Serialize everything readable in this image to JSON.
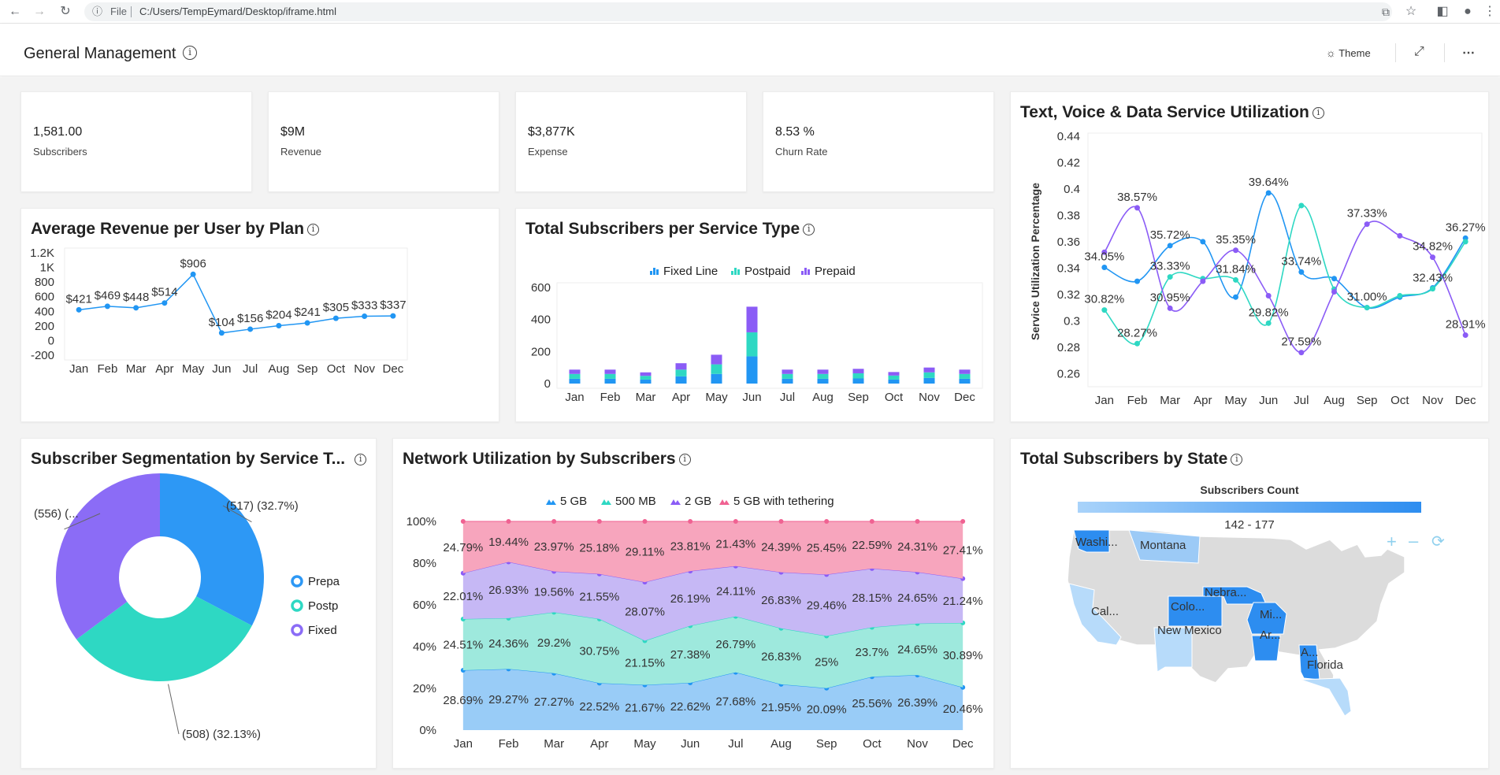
{
  "browser": {
    "file_label": "File",
    "url": "C:/Users/TempEymard/Desktop/iframe.html"
  },
  "header": {
    "title": "General Management",
    "theme_label": "Theme"
  },
  "kpis": [
    {
      "value": "1,581.00",
      "label": "Subscribers"
    },
    {
      "value": "$9M",
      "label": "Revenue"
    },
    {
      "value": "$3,877K",
      "label": "Expense"
    },
    {
      "value": "8.53 %",
      "label": "Churn Rate"
    }
  ],
  "arpu": {
    "title": "Average Revenue per User by Plan",
    "chart_data": {
      "type": "line",
      "categories": [
        "Jan",
        "Feb",
        "Mar",
        "Apr",
        "May",
        "Jun",
        "Jul",
        "Aug",
        "Sep",
        "Oct",
        "Nov",
        "Dec"
      ],
      "values": [
        421,
        469,
        448,
        514,
        906,
        104,
        156,
        204,
        241,
        305,
        333,
        337
      ],
      "labels": [
        "$421",
        "$469",
        "$448",
        "$514",
        "$906",
        "$104",
        "$156",
        "$204",
        "$241",
        "$305",
        "$333",
        "$337"
      ],
      "yticks": [
        "1.2K",
        "1K",
        "800",
        "600",
        "400",
        "200",
        "0",
        "-200"
      ],
      "ylim": [
        -200,
        1200
      ],
      "color": "#2196f3"
    }
  },
  "service_type": {
    "title": "Total Subscribers per Service Type",
    "chart_data": {
      "type": "bar",
      "stacked": true,
      "categories": [
        "Jan",
        "Feb",
        "Mar",
        "Apr",
        "May",
        "Jun",
        "Jul",
        "Aug",
        "Sep",
        "Oct",
        "Nov",
        "Dec"
      ],
      "series": [
        {
          "name": "Fixed Line",
          "color": "#2196f3",
          "values": [
            30,
            30,
            25,
            45,
            60,
            170,
            30,
            30,
            32,
            25,
            35,
            30
          ]
        },
        {
          "name": "Postpaid",
          "color": "#2ed8c3",
          "values": [
            30,
            30,
            23,
            42,
            60,
            150,
            30,
            30,
            32,
            25,
            35,
            30
          ]
        },
        {
          "name": "Prepaid",
          "color": "#8b5cf6",
          "values": [
            27,
            27,
            22,
            40,
            60,
            160,
            27,
            27,
            28,
            22,
            30,
            27
          ]
        }
      ],
      "yticks": [
        "600",
        "400",
        "200",
        "0"
      ],
      "ylim": [
        0,
        600
      ]
    }
  },
  "utilization": {
    "title": "Text, Voice & Data Service Utilization",
    "chart_data": {
      "type": "line",
      "categories": [
        "Jan",
        "Feb",
        "Mar",
        "Apr",
        "May",
        "Jun",
        "Jul",
        "Aug",
        "Sep",
        "Oct",
        "Nov",
        "Dec"
      ],
      "ylabel": "Service Utilization Percentage",
      "yticks": [
        "0.44",
        "0.42",
        "0.4",
        "0.38",
        "0.36",
        "0.34",
        "0.32",
        "0.3",
        "0.28",
        "0.26"
      ],
      "ylim": [
        0.25,
        0.44
      ],
      "series": [
        {
          "color": "#2196f3",
          "values": [
            0.3405,
            0.33,
            0.357,
            0.36,
            0.318,
            0.397,
            0.337,
            0.332,
            0.31,
            0.318,
            0.325,
            0.3627
          ]
        },
        {
          "color": "#2ed8c3",
          "values": [
            0.3082,
            0.2827,
            0.3333,
            0.332,
            0.331,
            0.2982,
            0.3874,
            0.324,
            0.31,
            0.319,
            0.3243,
            0.36
          ]
        },
        {
          "color": "#8b5cf6",
          "values": [
            0.352,
            0.3857,
            0.3095,
            0.33,
            0.3535,
            0.319,
            0.2759,
            0.322,
            0.3733,
            0.3645,
            0.3482,
            0.2891
          ]
        }
      ],
      "labels": [
        {
          "text": "34.05%",
          "series": 0,
          "index": 0
        },
        {
          "text": "30.82%",
          "series": 1,
          "index": 0
        },
        {
          "text": "38.57%",
          "series": 2,
          "index": 1
        },
        {
          "text": "28.27%",
          "series": 1,
          "index": 1
        },
        {
          "text": "35.72%",
          "series": 0,
          "index": 2
        },
        {
          "text": "33.33%",
          "series": 1,
          "index": 2
        },
        {
          "text": "30.95%",
          "series": 2,
          "index": 2
        },
        {
          "text": "35.35%",
          "series": 2,
          "index": 4
        },
        {
          "text": "31.84%",
          "series": 1,
          "index": 4
        },
        {
          "text": "39.64%",
          "series": 0,
          "index": 5
        },
        {
          "text": "29.82%",
          "series": 1,
          "index": 5
        },
        {
          "text": "33.74%",
          "series": 0,
          "index": 6
        },
        {
          "text": "27.59%",
          "series": 2,
          "index": 6
        },
        {
          "text": "37.33%",
          "series": 2,
          "index": 8
        },
        {
          "text": "31.00%",
          "series": 0,
          "index": 8
        },
        {
          "text": "32.43%",
          "series": 1,
          "index": 10
        },
        {
          "text": "36.27%",
          "series": 0,
          "index": 11
        },
        {
          "text": "34.82%",
          "series": 2,
          "index": 10
        },
        {
          "text": "28.91%",
          "series": 2,
          "index": 11
        }
      ]
    }
  },
  "segmentation": {
    "title": "Subscriber Segmentation by Service T...",
    "chart_data": {
      "type": "pie",
      "donut": true,
      "slices": [
        {
          "legend": "Prepa",
          "value": 517,
          "label": "(517) (32.7%)",
          "color": "#2d98f5"
        },
        {
          "legend": "Postp",
          "value": 508,
          "label": "(508) (32.13%)",
          "color": "#2ed8c3"
        },
        {
          "legend": "Fixed",
          "value": 556,
          "label": "(556) (...",
          "color": "#8b6cf6"
        }
      ]
    }
  },
  "network": {
    "title": "Network Utilization by Subscribers",
    "chart_data": {
      "type": "area",
      "stacked100": true,
      "categories": [
        "Jan",
        "Feb",
        "Mar",
        "Apr",
        "May",
        "Jun",
        "Jul",
        "Aug",
        "Sep",
        "Oct",
        "Nov",
        "Dec"
      ],
      "yticks": [
        "100%",
        "80%",
        "60%",
        "40%",
        "20%",
        "0%"
      ],
      "series": [
        {
          "name": "5 GB",
          "color": "#99ccf7",
          "line": "#2196f3",
          "values": [
            28.69,
            29.27,
            27.27,
            22.52,
            21.67,
            22.62,
            27.68,
            21.95,
            20.09,
            25.56,
            26.39,
            20.46
          ]
        },
        {
          "name": "500 MB",
          "color": "#9ee9dd",
          "line": "#2ed8c3",
          "values": [
            24.51,
            24.36,
            29.2,
            30.75,
            21.15,
            27.38,
            26.79,
            26.83,
            25,
            23.7,
            24.65,
            30.89
          ]
        },
        {
          "name": "2 GB",
          "color": "#c6b8f5",
          "line": "#8b5cf6",
          "values": [
            22.01,
            26.93,
            19.56,
            21.55,
            28.07,
            26.19,
            24.11,
            26.83,
            29.46,
            28.15,
            24.65,
            21.24
          ]
        },
        {
          "name": "5 GB with tethering",
          "color": "#f7a5bd",
          "line": "#f06292",
          "values": [
            24.79,
            19.44,
            23.97,
            25.18,
            29.11,
            23.81,
            21.43,
            24.39,
            25.45,
            22.59,
            24.31,
            27.41
          ]
        }
      ],
      "value_labels": [
        [
          "28.69%",
          "29.27%",
          "27.27%",
          "22.52%",
          "21.67%",
          "22.62%",
          "27.68%",
          "21.95%",
          "20.09%",
          "25.56%",
          "26.39%",
          "20.46%"
        ],
        [
          "24.51%",
          "24.36%",
          "29.2%",
          "30.75%",
          "21.15%",
          "27.38%",
          "26.79%",
          "26.83%",
          "25%",
          "23.7%",
          "24.65%",
          "30.89%"
        ],
        [
          "22.01%",
          "26.93%",
          "19.56%",
          "21.55%",
          "28.07%",
          "26.19%",
          "24.11%",
          "26.83%",
          "29.46%",
          "28.15%",
          "24.65%",
          "21.24%"
        ],
        [
          "24.79%",
          "19.44%",
          "23.97%",
          "25.18%",
          "29.11%",
          "23.81%",
          "21.43%",
          "24.39%",
          "25.45%",
          "22.59%",
          "24.31%",
          "27.41%"
        ]
      ]
    }
  },
  "states": {
    "title": "Total Subscribers by State",
    "legend_title": "Subscribers Count",
    "range_label": "142 - 177",
    "state_labels": [
      "Washi...",
      "Montana",
      "Nebra...",
      "Colo...",
      "Mi...",
      "Cal...",
      "Ar...",
      "New Mexico",
      "A...",
      "Florida"
    ]
  }
}
